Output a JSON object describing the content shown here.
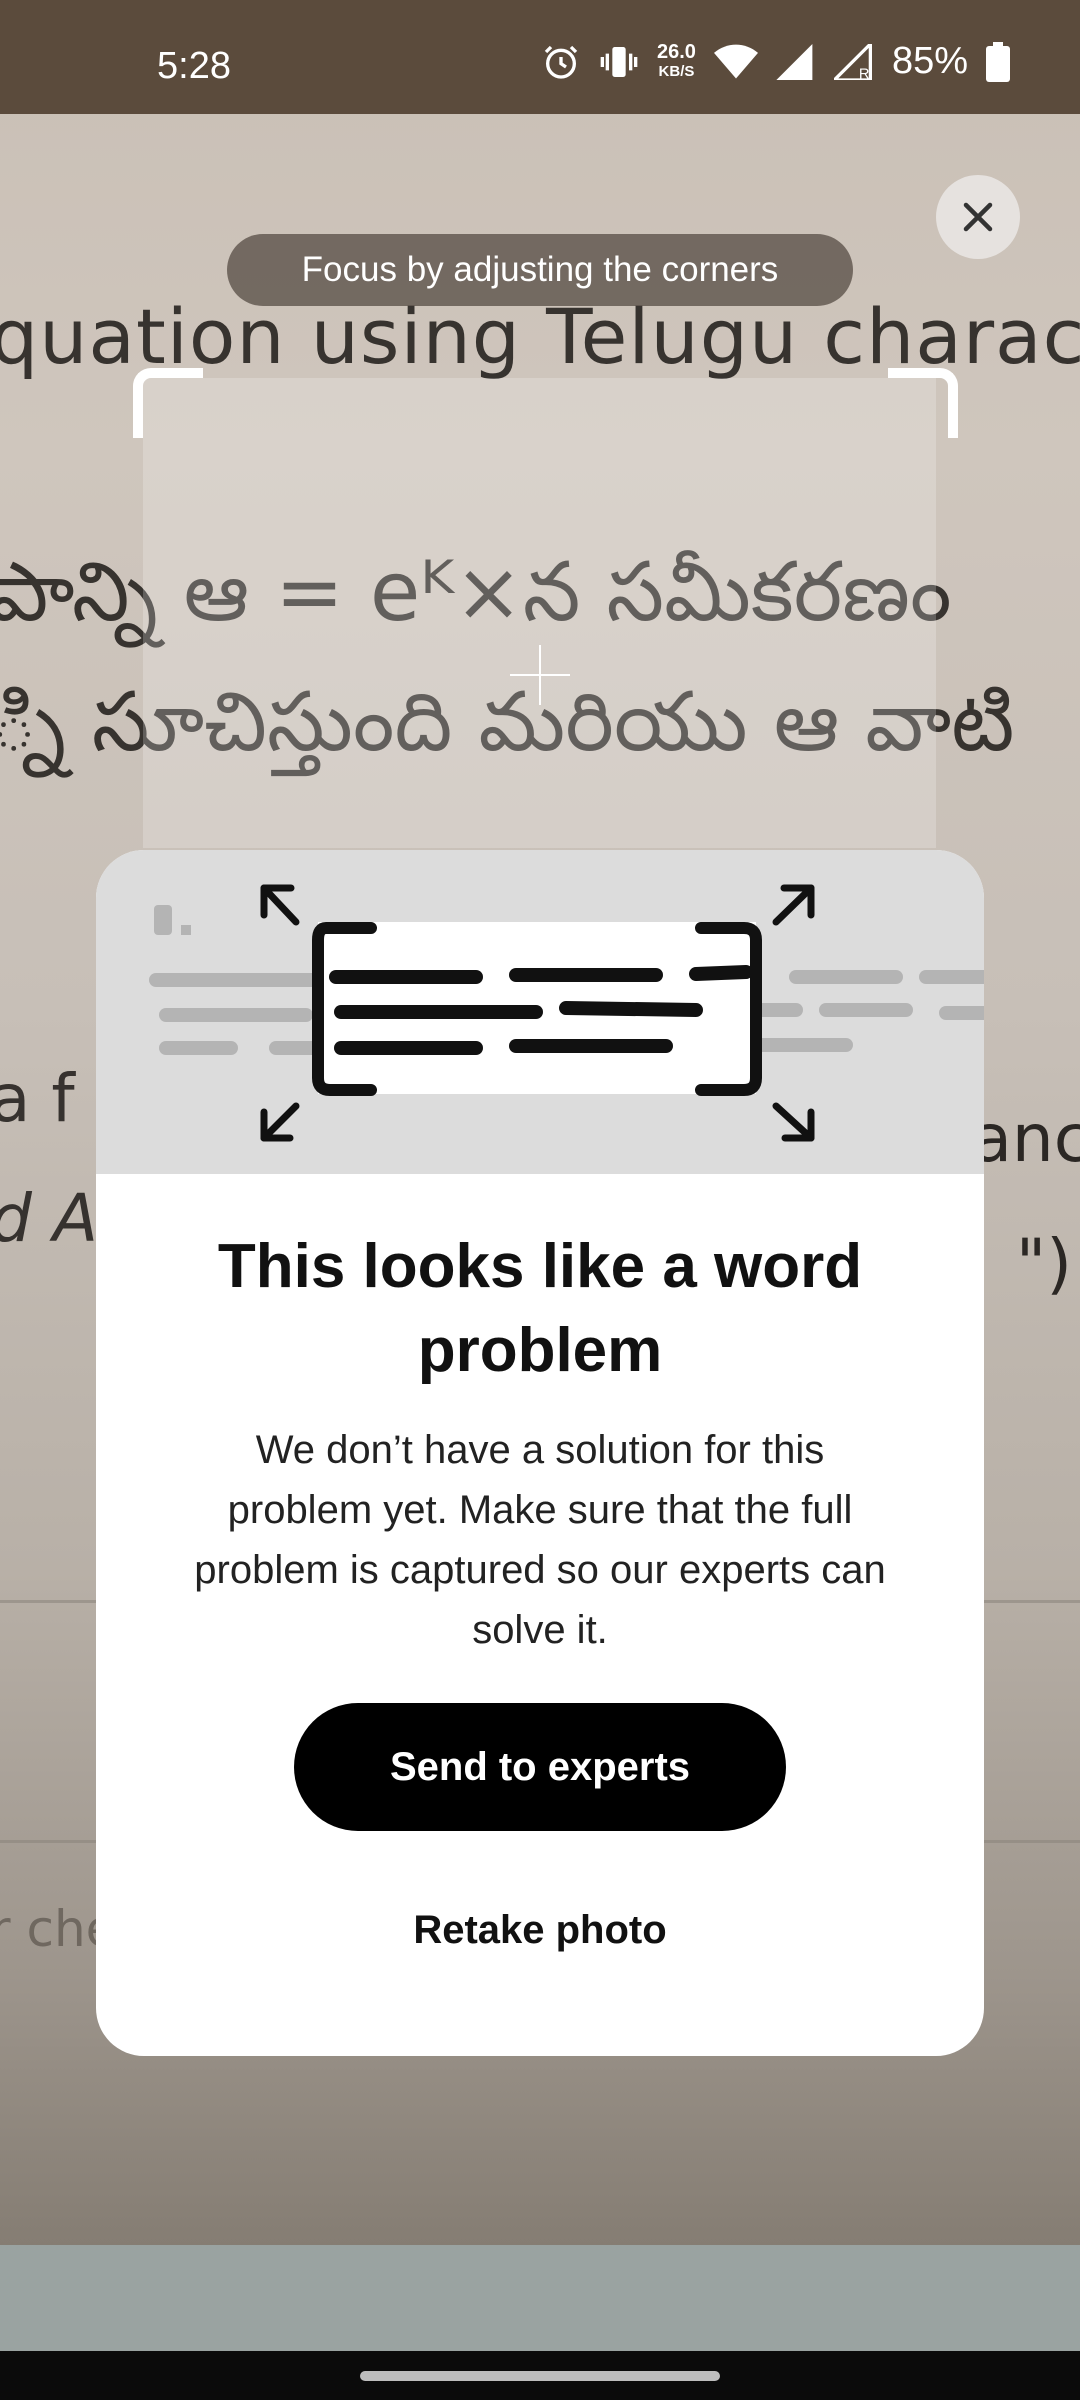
{
  "status_bar": {
    "time": "5:28",
    "net_speed_value": "26.0",
    "net_speed_unit": "KB/S",
    "battery_percent": "85%",
    "icons": [
      "alarm-icon",
      "vibrate-icon",
      "wifi-icon",
      "signal-icon",
      "signal-roaming-icon",
      "battery-icon"
    ]
  },
  "camera": {
    "line1": "quation using Telugu character",
    "line2": "పాన్ని ఆ = eᴷ×న సమీకరణం",
    "line3": "్ని సూచిస్తుంది మరియు ఆ వాటి",
    "frag_left1": "a f",
    "frag_left2": "d A",
    "frag_left3": "r che",
    "frag_right1": "anc",
    "frag_right2": "\")"
  },
  "hint": "Focus by adjusting the corners",
  "close_label": "Close",
  "dialog": {
    "title": "This looks like a word problem",
    "body": "We don’t have a solution for this problem yet. Make sure that the full problem is captured so our experts can solve it.",
    "primary_button": "Send to experts",
    "secondary_button": "Retake photo"
  },
  "colors": {
    "status_bar_bg": "#5b4b3c",
    "dialog_bg": "#ffffff",
    "illustration_bg": "#dcdcdc",
    "primary_button_bg": "#000000",
    "bottom_panel": "#9aa3a1"
  }
}
